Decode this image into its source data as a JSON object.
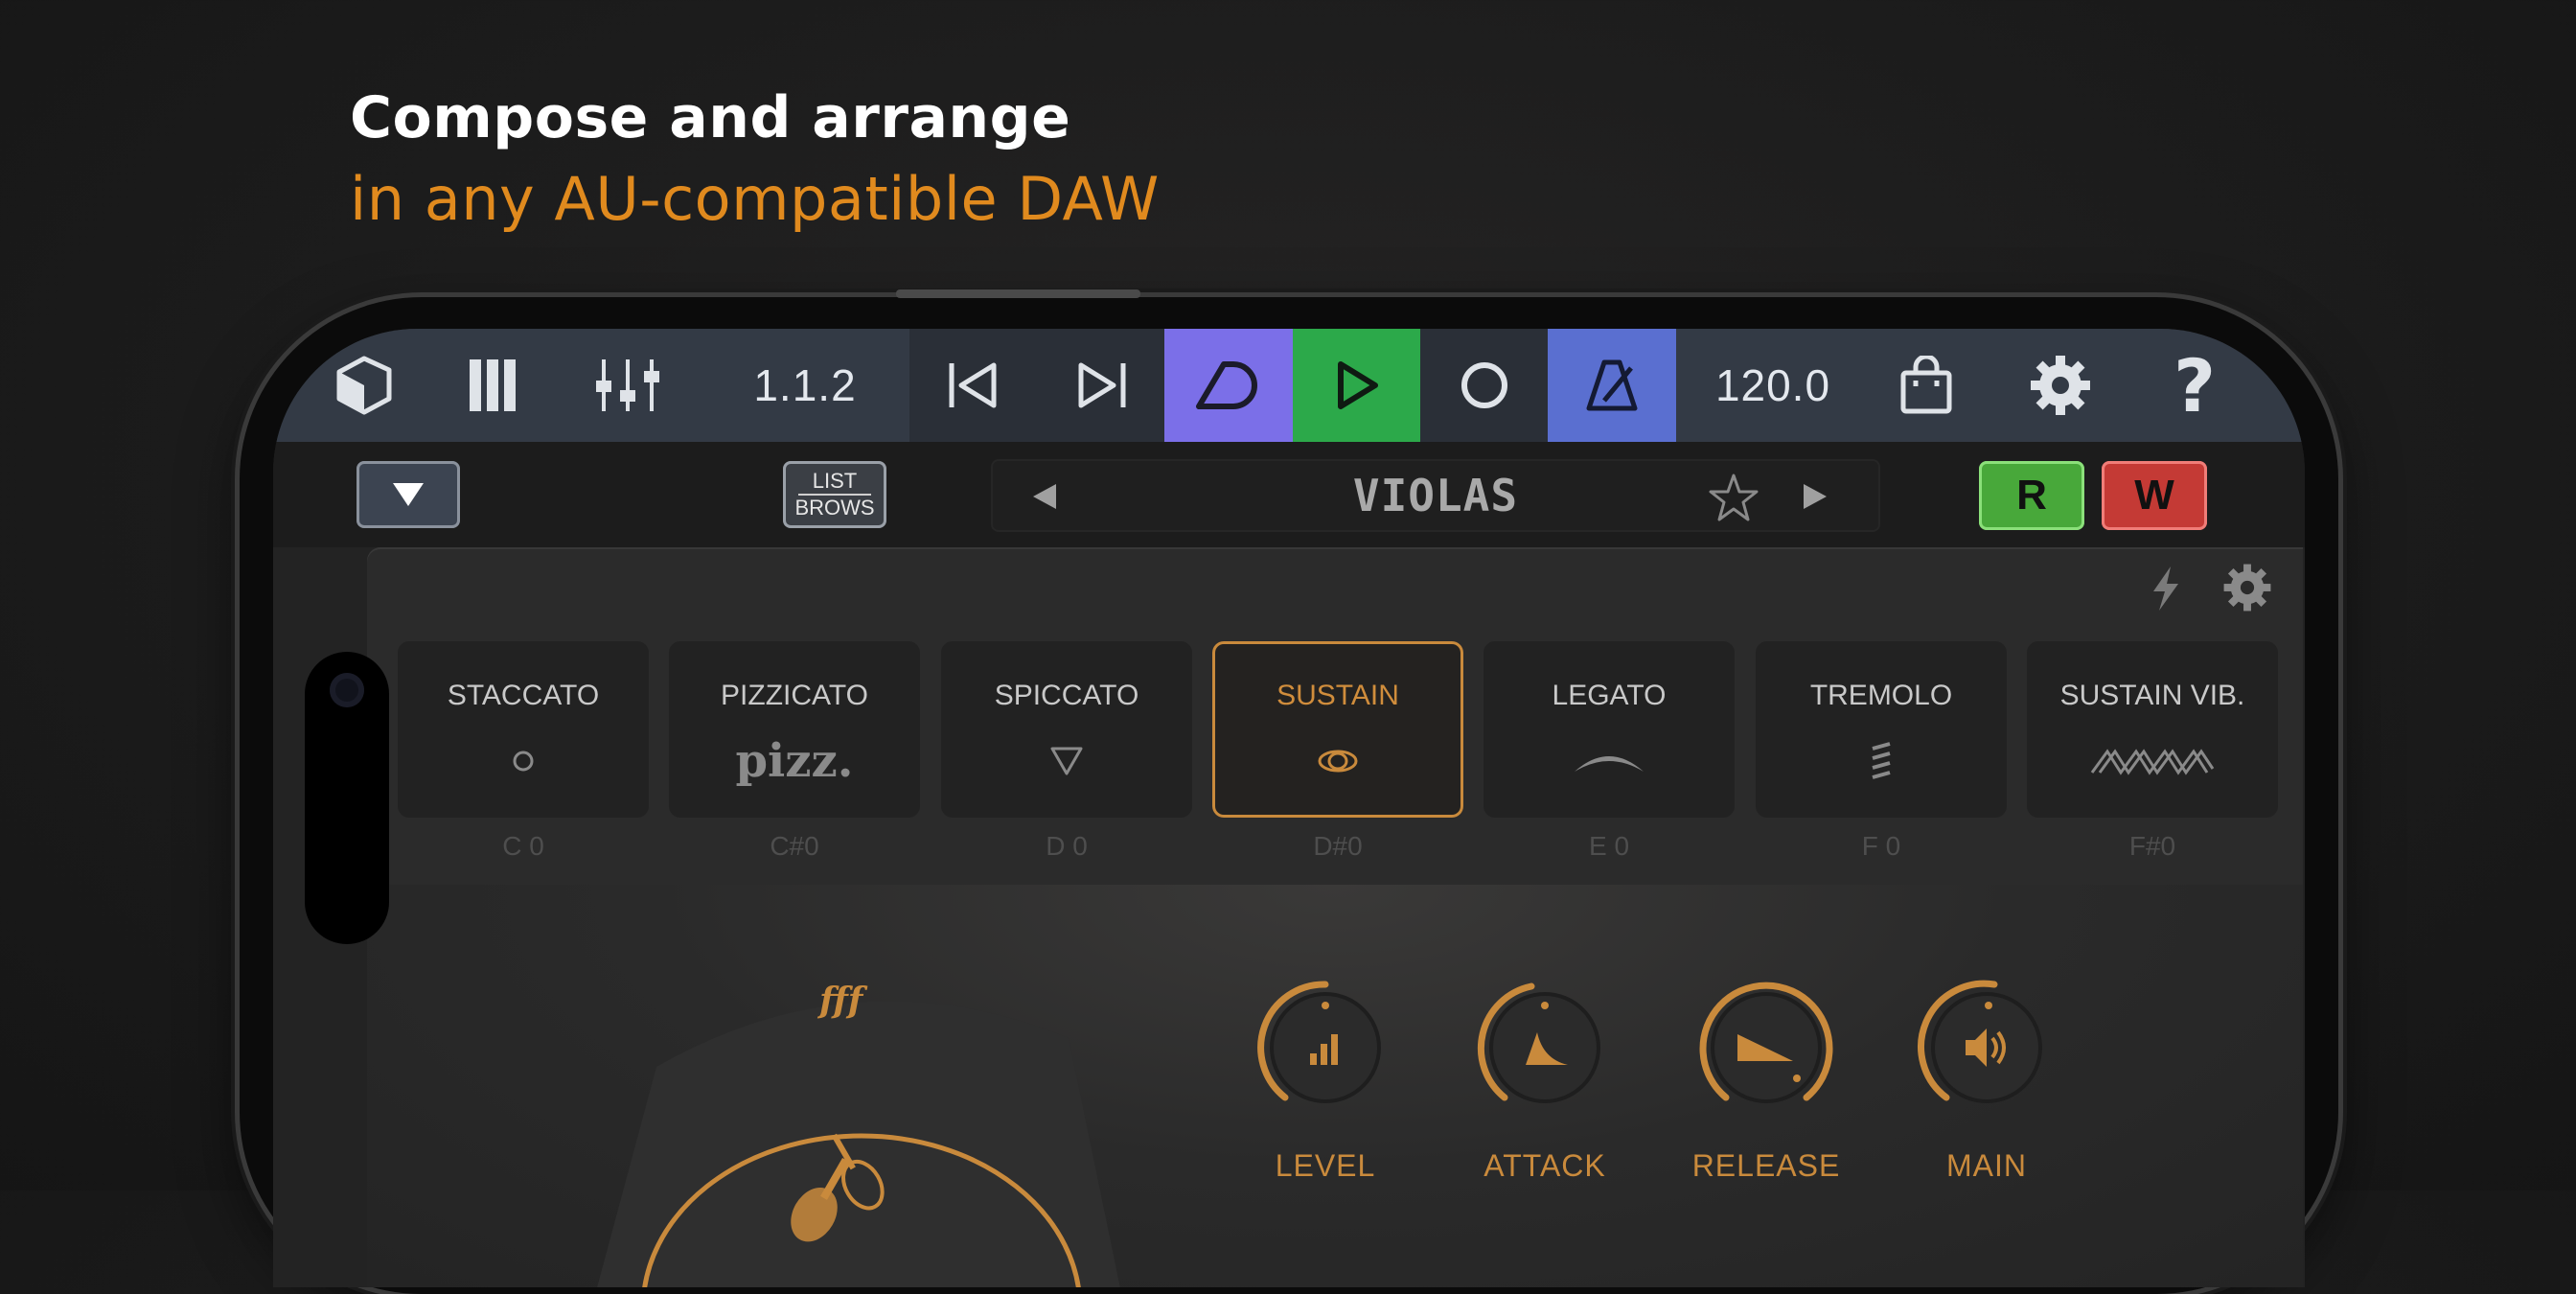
{
  "headline": {
    "line1": "Compose and arrange",
    "line2": "in any AU-compatible DAW"
  },
  "toolbar": {
    "position": "1.1.2",
    "tempo": "120.0",
    "icons": [
      "cube-icon",
      "piano-keys-icon",
      "mixer-icon",
      "skip-back-icon",
      "skip-forward-icon",
      "loop-icon",
      "play-icon",
      "record-icon",
      "metronome-icon",
      "shop-bag-icon",
      "gear-icon",
      "help-icon"
    ],
    "colors": {
      "loop": "#7b6fe8",
      "play": "#2ca94a",
      "metronome": "#5a6fd0"
    }
  },
  "bar2": {
    "list_browse_line1": "LIST",
    "list_browse_line2": "BROWS",
    "preset_name": "VIOLAS",
    "r_label": "R",
    "w_label": "W",
    "colors": {
      "r": "#48a83a",
      "w": "#c43a35"
    }
  },
  "articulations": [
    {
      "label": "STACCATO",
      "key": "C 0",
      "symbol": "dot",
      "active": false
    },
    {
      "label": "PIZZICATO",
      "key": "C#0",
      "symbol": "pizz.",
      "active": false
    },
    {
      "label": "SPICCATO",
      "key": "D 0",
      "symbol": "triangle",
      "active": false
    },
    {
      "label": "SUSTAIN",
      "key": "D#0",
      "symbol": "rings",
      "active": true
    },
    {
      "label": "LEGATO",
      "key": "E 0",
      "symbol": "arc",
      "active": false
    },
    {
      "label": "TREMOLO",
      "key": "F 0",
      "symbol": "tremolo",
      "active": false
    },
    {
      "label": "SUSTAIN VIB.",
      "key": "F#0",
      "symbol": "wave",
      "active": false
    }
  ],
  "dynamics": {
    "marking": "fff"
  },
  "knobs": [
    {
      "label": "LEVEL",
      "icon": "bars-icon",
      "value": 0.5
    },
    {
      "label": "ATTACK",
      "icon": "attack-envelope-icon",
      "value": 0.3
    },
    {
      "label": "RELEASE",
      "icon": "release-envelope-icon",
      "value": 0.95
    },
    {
      "label": "MAIN",
      "icon": "speaker-icon",
      "value": 0.55
    }
  ],
  "accent_color": "#c98a3c"
}
